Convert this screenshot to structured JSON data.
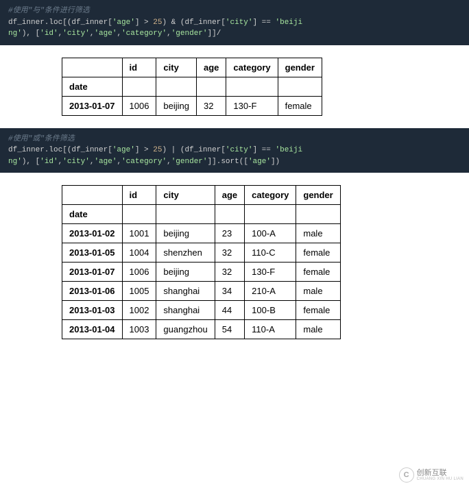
{
  "code1": {
    "comment": "#使用\"与\"条件进行筛选",
    "line1_a": "df_inner.loc[(df_inner[",
    "line1_b": "'age'",
    "line1_c": "] > ",
    "line1_d": "25",
    "line1_e": ") & (df_inner[",
    "line1_f": "'city'",
    "line1_g": "] == ",
    "line1_h": "'beiji",
    "line2_a": "ng'",
    "line2_b": "), [",
    "line2_c": "'id'",
    "line2_d": ",",
    "line2_e": "'city'",
    "line2_f": ",",
    "line2_g": "'age'",
    "line2_h": ",",
    "line2_i": "'category'",
    "line2_j": ",",
    "line2_k": "'gender'",
    "line2_l": "]]/"
  },
  "table1": {
    "headers": [
      "",
      "id",
      "city",
      "age",
      "category",
      "gender"
    ],
    "index_label": "date",
    "rows": [
      {
        "date": "2013-01-07",
        "id": "1006",
        "city": "beijing",
        "age": "32",
        "category": "130-F",
        "gender": "female"
      }
    ]
  },
  "code2": {
    "comment": "#使用\"或\"条件筛选",
    "line1_a": "df_inner.loc[(df_inner[",
    "line1_b": "'age'",
    "line1_c": "] > ",
    "line1_d": "25",
    "line1_e": ") | (df_inner[",
    "line1_f": "'city'",
    "line1_g": "] == ",
    "line1_h": "'beiji",
    "line2_a": "ng'",
    "line2_b": "), [",
    "line2_c": "'id'",
    "line2_d": ",",
    "line2_e": "'city'",
    "line2_f": ",",
    "line2_g": "'age'",
    "line2_h": ",",
    "line2_i": "'category'",
    "line2_j": ",",
    "line2_k": "'gender'",
    "line2_l": "]].sort([",
    "line2_m": "'age'",
    "line2_n": "])"
  },
  "table2": {
    "headers": [
      "",
      "id",
      "city",
      "age",
      "category",
      "gender"
    ],
    "index_label": "date",
    "rows": [
      {
        "date": "2013-01-02",
        "id": "1001",
        "city": "beijing",
        "age": "23",
        "category": "100-A",
        "gender": "male"
      },
      {
        "date": "2013-01-05",
        "id": "1004",
        "city": "shenzhen",
        "age": "32",
        "category": "110-C",
        "gender": "female"
      },
      {
        "date": "2013-01-07",
        "id": "1006",
        "city": "beijing",
        "age": "32",
        "category": "130-F",
        "gender": "female"
      },
      {
        "date": "2013-01-06",
        "id": "1005",
        "city": "shanghai",
        "age": "34",
        "category": "210-A",
        "gender": "male"
      },
      {
        "date": "2013-01-03",
        "id": "1002",
        "city": "shanghai",
        "age": "44",
        "category": "100-B",
        "gender": "female"
      },
      {
        "date": "2013-01-04",
        "id": "1003",
        "city": "guangzhou",
        "age": "54",
        "category": "110-A",
        "gender": "male"
      }
    ]
  },
  "watermark": {
    "logo_char": "C",
    "cn": "创新互联",
    "en": "CHUANG XIN HU LIAN"
  }
}
